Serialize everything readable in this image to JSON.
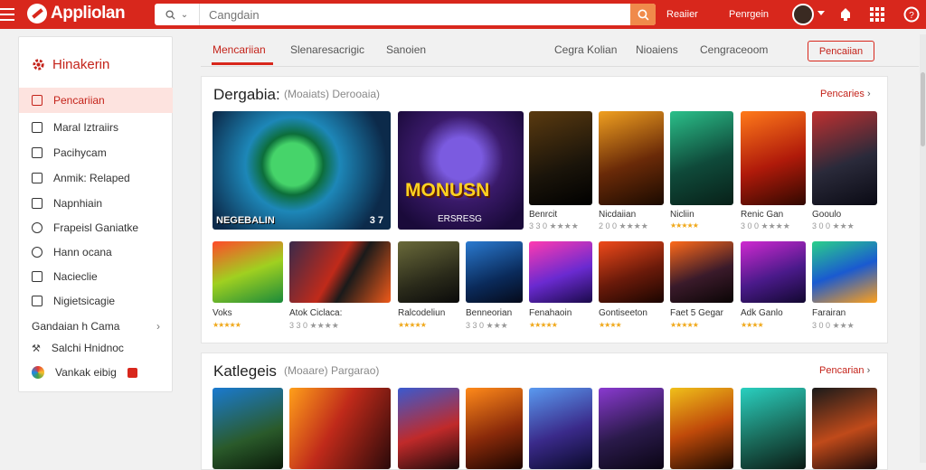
{
  "app": {
    "title": "Appliolan"
  },
  "search": {
    "scope_icon": "search-icon",
    "placeholder": "Cangdain"
  },
  "topbar": {
    "link1": "Reaiier",
    "link2": "Penrgein"
  },
  "sidebar": {
    "heading": "Hinakerin",
    "items": [
      {
        "label": "Pencariian",
        "active": true
      },
      {
        "label": "Maral Iztraiirs"
      },
      {
        "label": "Pacihycam"
      },
      {
        "label": "Anmik: Relaped"
      },
      {
        "label": "Napnhiain"
      },
      {
        "label": "Frapeisl Ganiatke"
      },
      {
        "label": "Hann ocana"
      },
      {
        "label": "Nacieclie"
      },
      {
        "label": "Nigietsicagie"
      },
      {
        "label": "Gandaian h Cama"
      },
      {
        "label": "Salchi Hnidnoc"
      },
      {
        "label": "Vankak eibig"
      }
    ]
  },
  "tabs": {
    "items": [
      "Mencariian",
      "Slenaresacrigic",
      "Sanoien",
      "Cegra Kolian",
      "Nioaiens",
      "Cengraceoom"
    ],
    "button": "Pencaiian"
  },
  "section1": {
    "title": "Dergabia:",
    "subtitle": "(Moaiats) Derooaia)",
    "more": "Pencaries",
    "featured": [
      {
        "banner": "NEGEBALIN",
        "badge": "3 7"
      },
      {
        "banner": "MONUSN",
        "badge": "ERSRESG"
      }
    ],
    "row1": [
      {
        "name": "Benrcit",
        "sub": "3 3 0 ★★★★"
      },
      {
        "name": "Nicdaiian",
        "sub": "2 0 0 ★★★★"
      },
      {
        "name": "Nicliin",
        "sub": "★★★★★"
      },
      {
        "name": "Renic Gan",
        "sub": "3 0 0 ★★★★"
      },
      {
        "name": "Gooulo",
        "sub": "3 0 0 ★★★"
      }
    ],
    "row2": [
      {
        "name": "Voks",
        "sub": "★★★★★"
      },
      {
        "name": "Atok Ciclaca:",
        "sub": "3 3 0 ★★★★"
      },
      {
        "name": "Ralcodeliun",
        "sub": "★★★★★"
      },
      {
        "name": "Benneorian",
        "sub": "3 3 0 ★★★"
      },
      {
        "name": "Fenahaoin",
        "sub": "★★★★★"
      },
      {
        "name": "Gontiseeton",
        "sub": "★★★★"
      },
      {
        "name": "Faet 5 Gegar",
        "sub": "★★★★★"
      },
      {
        "name": "Adk Ganlo",
        "sub": "★★★★"
      },
      {
        "name": "Farairan",
        "sub": "3 0 0 ★★★"
      }
    ]
  },
  "section2": {
    "title": "Katlegeis",
    "subtitle": "(Moaare) Pargarao)",
    "more": "Pencarian"
  },
  "colors": {
    "accent": "#d8271c",
    "star": "#f0a81a"
  }
}
